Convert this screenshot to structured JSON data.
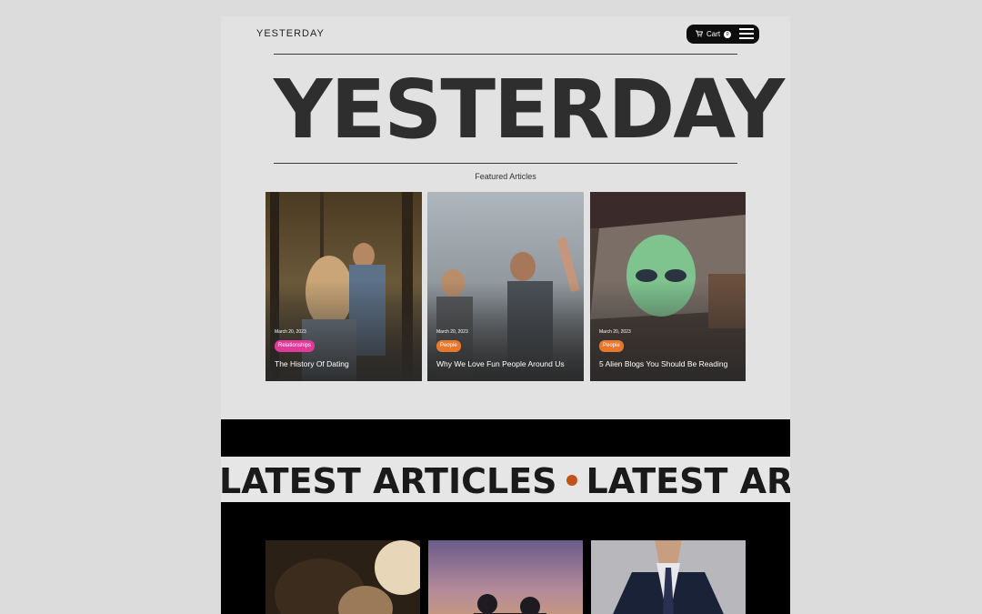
{
  "header": {
    "logo": "YESTERDAY",
    "cart_label": "Cart",
    "cart_count": "0",
    "cart_icon": "cart-icon",
    "menu_icon": "hamburger-icon"
  },
  "hero": {
    "title": "YESTERDAY"
  },
  "featured": {
    "label": "Featured Articles",
    "cards": [
      {
        "date": "March 20, 2023",
        "tag": "Relationships",
        "tag_color": "#e0399a",
        "title": "The History Of Dating"
      },
      {
        "date": "March 20, 2023",
        "tag": "People",
        "tag_color": "#e8772e",
        "title": "Why We Love Fun People Around Us"
      },
      {
        "date": "March 20, 2023",
        "tag": "People",
        "tag_color": "#e8772e",
        "title": "5 Alien Blogs You Should Be Reading"
      }
    ]
  },
  "latest": {
    "marquee_1": "LATEST ARTICLES",
    "marquee_2": "LATEST ARTICLES",
    "dot_color": "#c0521a"
  },
  "colors": {
    "page_bg": "#dcdcdc",
    "content_bg": "#e2e2e2",
    "band": "#000000"
  }
}
